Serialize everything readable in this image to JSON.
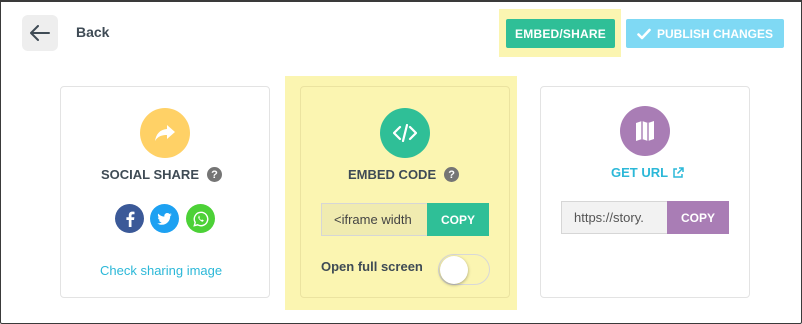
{
  "header": {
    "back_label": "Back",
    "embed_share_label": "EMBED/SHARE",
    "publish_label": "PUBLISH CHANGES"
  },
  "social": {
    "title": "SOCIAL SHARE",
    "check_link": "Check sharing image",
    "icons": [
      "facebook-icon",
      "twitter-icon",
      "whatsapp-icon"
    ]
  },
  "embed": {
    "title": "EMBED CODE",
    "code_value": "<iframe width",
    "copy_label": "COPY",
    "fullscreen_label": "Open full screen",
    "fullscreen_on": false
  },
  "url": {
    "title": "GET URL",
    "url_value": "https://story.",
    "copy_label": "COPY"
  },
  "colors": {
    "embed_green": "#2fbf97",
    "publish_blue": "#7fd9f4",
    "highlight_yellow": "#fbf5b1",
    "share_circle": "#ffd166",
    "url_purple": "#a97db5",
    "link_cyan": "#2cb8d8"
  }
}
